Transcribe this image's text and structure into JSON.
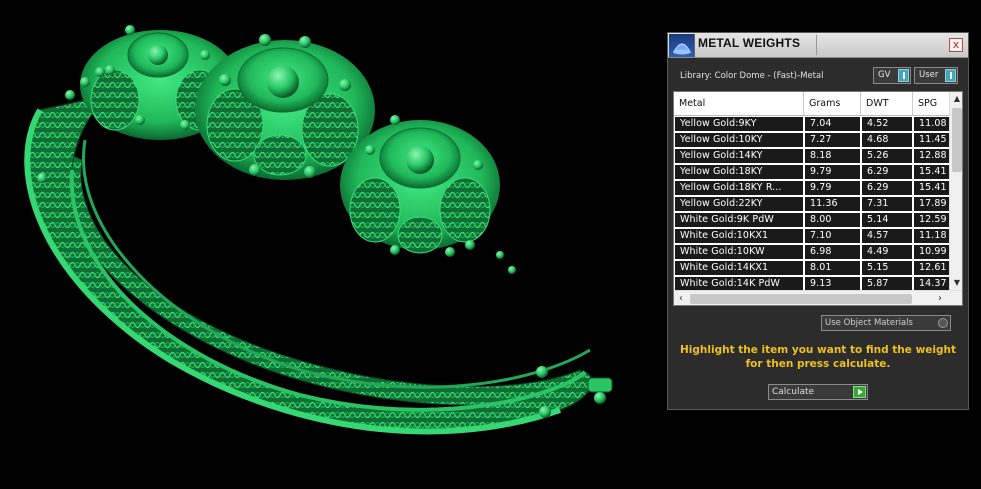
{
  "colors": {
    "model_green": "#2ed16a",
    "model_shadow": "#0c5a2a",
    "highlight_text": "#f0c020",
    "panel_bg": "#2c2c2c"
  },
  "panel": {
    "title": "METAL WEIGHTS",
    "title_icon": "dome-icon",
    "close_icon": "close-icon",
    "close_glyph": "x",
    "library_label": "Library: Color Dome - (Fast)-Metal",
    "toggle_gv": "GV",
    "toggle_user": "User",
    "columns": [
      "Metal",
      "Grams",
      "DWT",
      "SPG"
    ],
    "rows": [
      [
        "Yellow Gold:9KY",
        "7.04",
        "4.52",
        "11.08"
      ],
      [
        "Yellow Gold:10KY",
        "7.27",
        "4.68",
        "11.45"
      ],
      [
        "Yellow Gold:14KY",
        "8.18",
        "5.26",
        "12.88"
      ],
      [
        "Yellow Gold:18KY",
        "9.79",
        "6.29",
        "15.41"
      ],
      [
        "Yellow Gold:18KY R...",
        "9.79",
        "6.29",
        "15.41"
      ],
      [
        "Yellow Gold:22KY",
        "11.36",
        "7.31",
        "17.89"
      ],
      [
        "White Gold:9K PdW",
        "8.00",
        "5.14",
        "12.59"
      ],
      [
        "White Gold:10KX1",
        "7.10",
        "4.57",
        "11.18"
      ],
      [
        "White Gold:10KW",
        "6.98",
        "4.49",
        "10.99"
      ],
      [
        "White Gold:14KX1",
        "8.01",
        "5.15",
        "12.61"
      ],
      [
        "White Gold:14K PdW",
        "9.13",
        "5.87",
        "14.37"
      ]
    ],
    "use_object_materials": "Use Object Materials",
    "hint_line1": "Highlight the item you want to find the weight",
    "hint_line2": "for then press calculate.",
    "calculate_label": "Calculate"
  }
}
